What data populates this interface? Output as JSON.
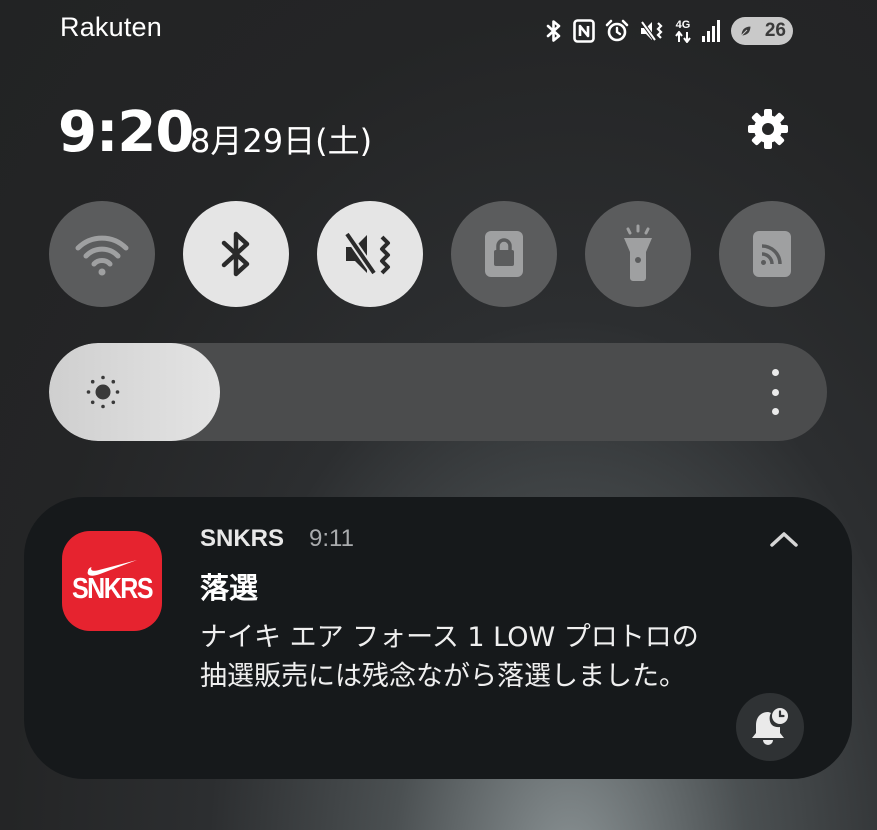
{
  "status_bar": {
    "carrier": "Rakuten",
    "network_label": "4G",
    "battery_level": "26",
    "icons": [
      "bluetooth-icon",
      "nfc-icon",
      "alarm-icon",
      "vibrate-icon",
      "4g-icon",
      "signal-icon",
      "battery-icon"
    ]
  },
  "header": {
    "time": "9:20",
    "date": "8月29日(土)",
    "settings_icon": "gear-icon"
  },
  "quick_tiles": [
    {
      "name": "wifi",
      "icon": "wifi-icon",
      "active": false
    },
    {
      "name": "bluetooth",
      "icon": "bluetooth-icon",
      "active": true
    },
    {
      "name": "vibrate",
      "icon": "vibrate-icon",
      "active": true
    },
    {
      "name": "screen-lock",
      "icon": "lock-icon",
      "active": false
    },
    {
      "name": "flashlight",
      "icon": "flashlight-icon",
      "active": false
    },
    {
      "name": "cast",
      "icon": "cast-icon",
      "active": false
    }
  ],
  "brightness": {
    "level": 0.22,
    "icon": "sun-icon",
    "menu_icon": "more-vertical-icon"
  },
  "notification": {
    "app_name": "SNKRS",
    "time": "9:11",
    "icon_text": "SNKRS",
    "title": "落選",
    "body_line1": "ナイキ エア フォース 1 LOW プロトロの",
    "body_line2": "抽選販売には残念ながら落選しました。",
    "collapse_icon": "chevron-up-icon",
    "snooze_icon": "snooze-bell-icon"
  },
  "colors": {
    "accent_on": "#e5e5e5",
    "tile_off": "#5b5c5d",
    "app_icon": "#e6232f",
    "card": "#16191b"
  }
}
